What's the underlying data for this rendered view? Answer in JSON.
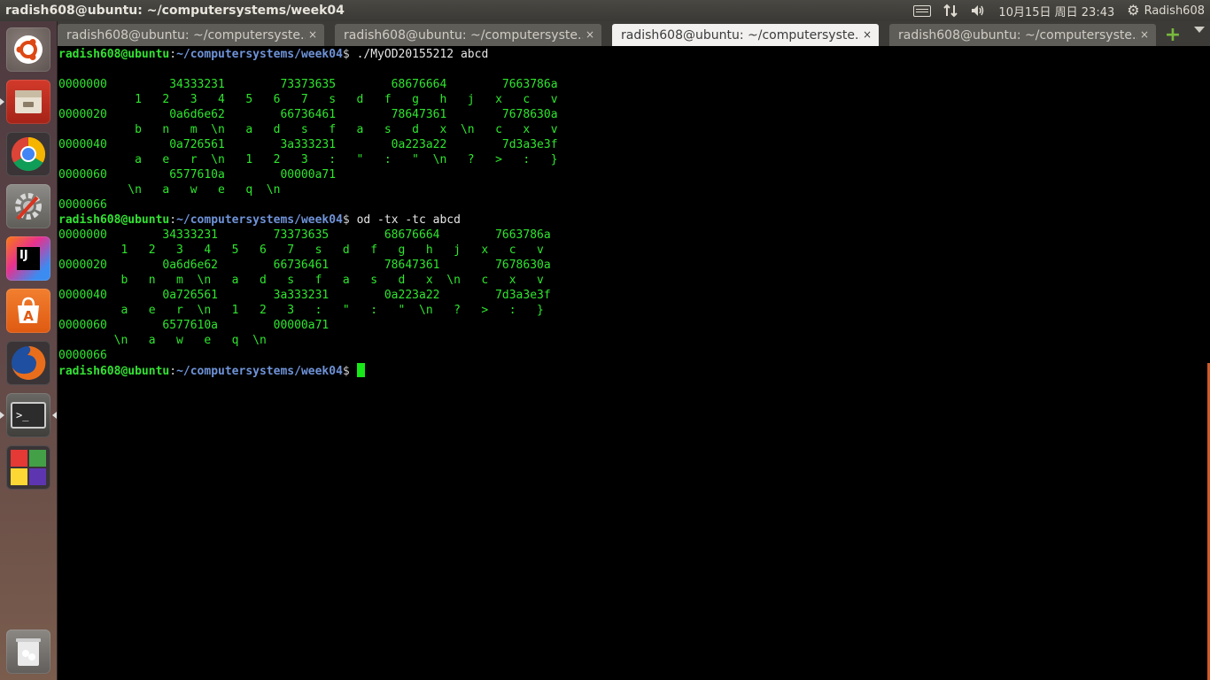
{
  "window": {
    "title": "radish608@ubuntu: ~/computersystems/week04"
  },
  "panel": {
    "datetime": "10月15日 周日 23:43",
    "user": "Radish608"
  },
  "icons": {
    "launcher": [
      "ubuntu-icon",
      "files-icon",
      "chrome-icon",
      "settings-icon",
      "intellij-icon",
      "software-center-icon",
      "firefox-icon",
      "terminal-icon",
      "workspaces-icon",
      "trash-icon"
    ],
    "panel": [
      "keyboard-icon",
      "network-icon",
      "volume-icon",
      "gear-icon"
    ]
  },
  "tabs": [
    {
      "label": "radish608@ubuntu: ~/computersyste...",
      "close": "×"
    },
    {
      "label": "radish608@ubuntu: ~/computersyste...",
      "close": "×"
    },
    {
      "label": "radish608@ubuntu: ~/computersyste...",
      "close": "×"
    },
    {
      "label": "radish608@ubuntu: ~/computersyste...",
      "close": "×"
    }
  ],
  "prompt": {
    "user": "radish608@ubuntu",
    "sep": ":",
    "path": "~/computersystems/week04",
    "sym": "$ "
  },
  "commands": {
    "c1": "./MyOD20155212 abcd",
    "c2": "od -tx -tc abcd",
    "c3": ""
  },
  "output1": [
    "0000000         34333231        73373635        68676664        7663786a",
    "           1   2   3   4   5   6   7   s   d   f   g   h   j   x   c   v",
    "0000020         0a6d6e62        66736461        78647361        7678630a",
    "           b   n   m  \\n   a   d   s   f   a   s   d   x  \\n   c   x   v",
    "0000040         0a726561        3a333231        0a223a22        7d3a3e3f",
    "           a   e   r  \\n   1   2   3   :   \"   :   \"  \\n   ?   >   :   }",
    "0000060         6577610a        00000a71",
    "          \\n   a   w   e   q  \\n",
    "0000066"
  ],
  "output2": [
    "0000000        34333231        73373635        68676664        7663786a",
    "         1   2   3   4   5   6   7   s   d   f   g   h   j   x   c   v",
    "0000020        0a6d6e62        66736461        78647361        7678630a",
    "         b   n   m  \\n   a   d   s   f   a   s   d   x  \\n   c   x   v",
    "0000040        0a726561        3a333231        0a223a22        7d3a3e3f",
    "         a   e   r  \\n   1   2   3   :   \"   :   \"  \\n   ?   >   :   }",
    "0000060        6577610a        00000a71",
    "        \\n   a   w   e   q  \\n",
    "0000066"
  ]
}
